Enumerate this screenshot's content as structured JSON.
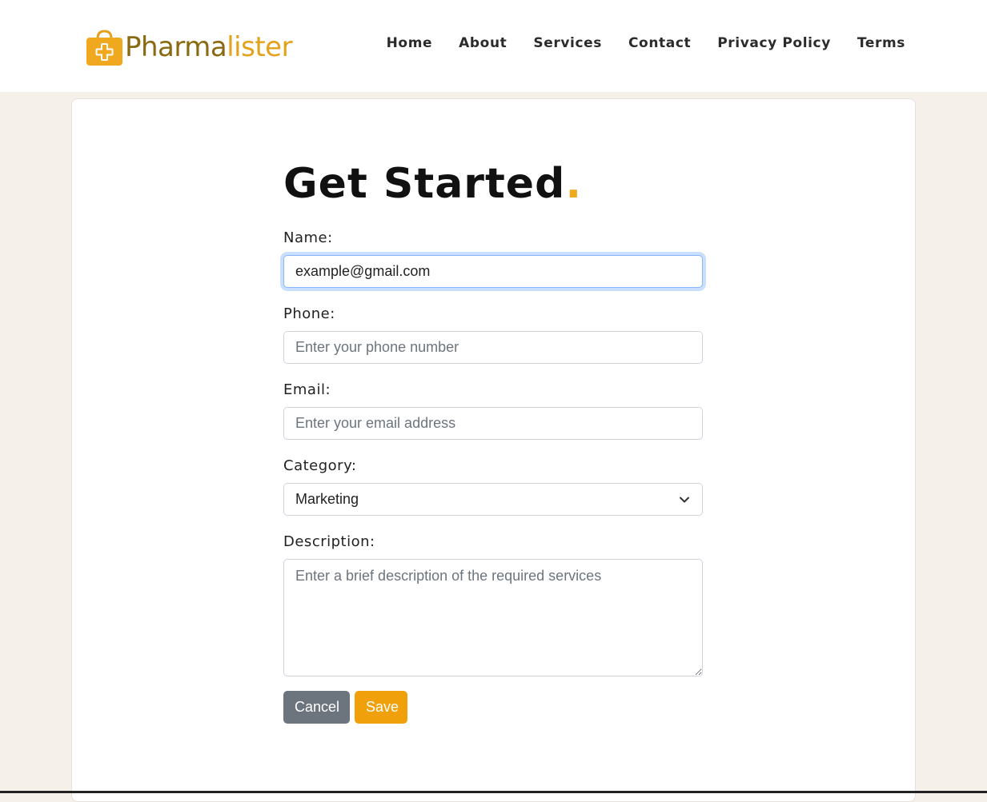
{
  "brand": {
    "name_part1": "Pharma",
    "name_part2": "lister",
    "icon": "shopping-bag-plus-icon",
    "color_dark": "#8a6a10",
    "color_accent": "#e4a11b"
  },
  "nav": {
    "items": [
      "Home",
      "About",
      "Services",
      "Contact",
      "Privacy Policy",
      "Terms"
    ]
  },
  "form": {
    "title": "Get Started",
    "title_dot": ".",
    "name_label": "Name:",
    "name_value": "example@gmail.com",
    "phone_label": "Phone:",
    "phone_placeholder": "Enter your phone number",
    "email_label": "Email:",
    "email_placeholder": "Enter your email address",
    "category_label": "Category:",
    "category_value": "Marketing",
    "description_label": "Description:",
    "description_placeholder": "Enter a brief description of the required services",
    "cancel_label": "Cancel",
    "save_label": "Save"
  },
  "colors": {
    "page_bg": "#f5f1ea",
    "accent": "#f0a00a",
    "cancel": "#6c757d"
  }
}
